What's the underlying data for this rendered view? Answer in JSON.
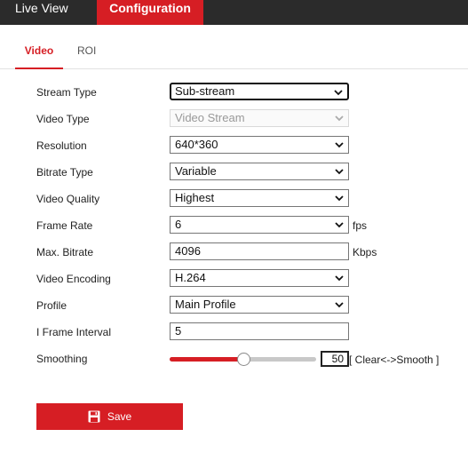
{
  "topnav": {
    "live_view": "Live View",
    "configuration": "Configuration"
  },
  "tabs": {
    "video": "Video",
    "roi": "ROI"
  },
  "form": {
    "stream_type": {
      "label": "Stream Type",
      "value": "Sub-stream"
    },
    "video_type": {
      "label": "Video Type",
      "value": "Video Stream"
    },
    "resolution": {
      "label": "Resolution",
      "value": "640*360"
    },
    "bitrate_type": {
      "label": "Bitrate Type",
      "value": "Variable"
    },
    "video_quality": {
      "label": "Video Quality",
      "value": "Highest"
    },
    "frame_rate": {
      "label": "Frame Rate",
      "value": "6",
      "unit": "fps"
    },
    "max_bitrate": {
      "label": "Max. Bitrate",
      "value": "4096",
      "unit": "Kbps"
    },
    "video_encoding": {
      "label": "Video Encoding",
      "value": "H.264"
    },
    "profile": {
      "label": "Profile",
      "value": "Main Profile"
    },
    "i_frame_interval": {
      "label": "I Frame Interval",
      "value": "5"
    },
    "smoothing": {
      "label": "Smoothing",
      "value": "50",
      "level_percent": 50,
      "hint": "[ Clear<->Smooth ]"
    }
  },
  "save": {
    "label": "Save"
  },
  "colors": {
    "accent": "#d61e24",
    "topbar": "#2b2b2b"
  }
}
